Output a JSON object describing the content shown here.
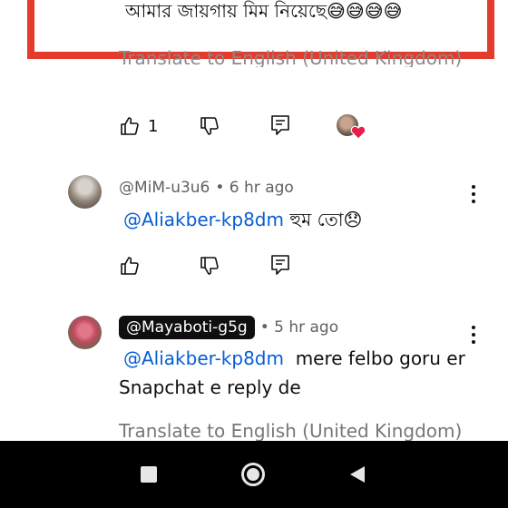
{
  "highlighted_comment": {
    "text": "আমার জায়গায় মিম নিয়েছে😅😅😅😅"
  },
  "translate_top": "Translate to English (United Kingdom)",
  "comment0_actions": {
    "like_count": "1"
  },
  "comment1": {
    "author": "@MiM-u3u6",
    "time": "• 6 hr ago",
    "mention": "@Aliakber-kp8dm",
    "text": " হুম তো😞"
  },
  "comment2": {
    "author": "@Mayaboti-g5g",
    "time": "• 5 hr ago",
    "mention": "@Aliakber-kp8dm",
    "text_line1": "  mere felbo goru er",
    "text_line2": "Snapchat e reply de",
    "translate": "Translate to English (United Kingdom)"
  },
  "colors": {
    "accent_red": "#e53b2c",
    "link_blue": "#065fd4",
    "heart": "#e91e4d"
  },
  "icons": [
    "like-icon",
    "dislike-icon",
    "reply-icon",
    "kebab-menu-icon",
    "stop-icon",
    "home-icon",
    "back-icon",
    "heart-icon"
  ]
}
